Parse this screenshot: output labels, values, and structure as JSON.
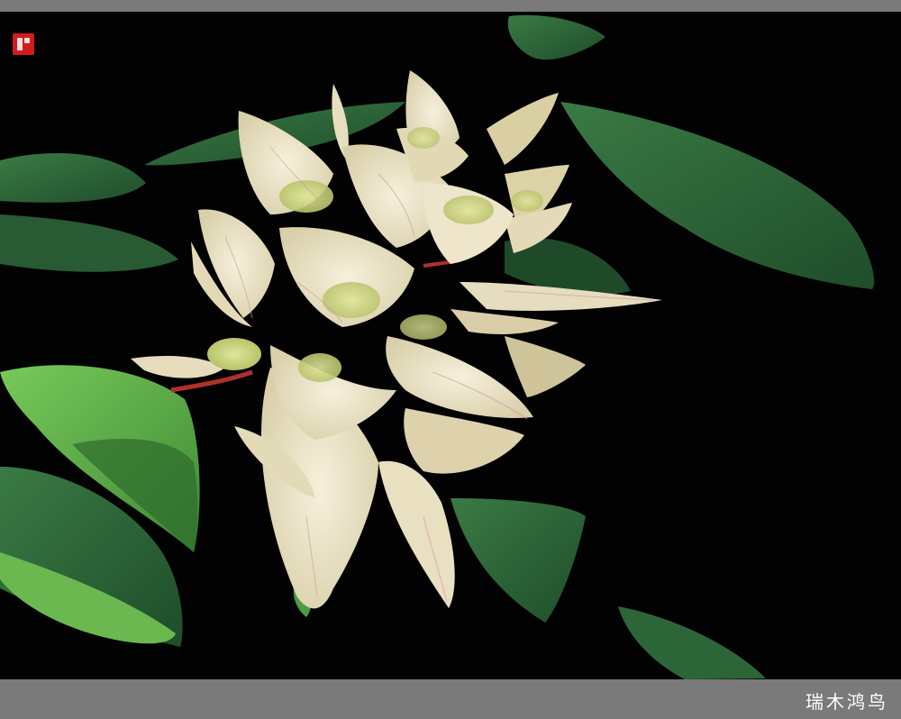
{
  "photo": {
    "subject": "flower-photo",
    "signature": "瑞木鸿鸟",
    "seal_text": "瑞木鸿鸟",
    "colors": {
      "frame": "#7a7a7a",
      "background": "#020202",
      "petal": "#efe7cf",
      "petal_shade": "#d8cfa8",
      "petal_green": "#c9d68a",
      "leaf": "#2f6b3a",
      "leaf_light": "#5fb34a",
      "stem": "#b0302c",
      "seal": "#d11c1c"
    }
  }
}
